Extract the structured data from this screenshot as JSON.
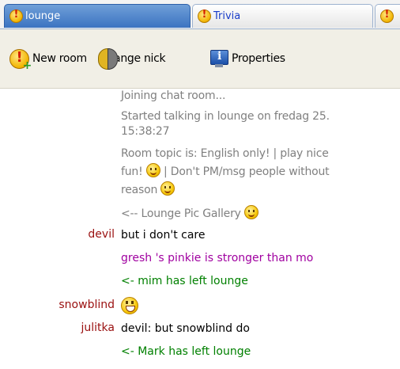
{
  "tabs": [
    {
      "label": "lounge",
      "active": true,
      "icon": "chat-bubble-icon"
    },
    {
      "label": "Trivia",
      "active": false,
      "icon": "chat-bubble-icon"
    },
    {
      "label": "",
      "active": false,
      "icon": "chat-bubble-icon"
    }
  ],
  "toolbar": {
    "new_room": "New room",
    "change_nick": "Change nick",
    "properties": "Properties"
  },
  "chat": {
    "system": {
      "joining": "Joining chat room...",
      "started": "Started talking in lounge on fredag 25.",
      "started_time": "15:38:27",
      "topic_line1": "Room topic is: English only! | play nice",
      "topic_line2_a": "fun!",
      "topic_line2_b": "| Don't PM/msg people without",
      "topic_line3": "reason",
      "gallery": "<-- Lounge Pic Gallery"
    },
    "messages": [
      {
        "nick": "devil",
        "text": "but i don't care"
      },
      {
        "nick": "",
        "text": "gresh 's pinkie is stronger than mo"
      },
      {
        "nick": "",
        "text": "<- mim has left lounge"
      },
      {
        "nick": "snowblind",
        "text": ""
      },
      {
        "nick": "julitka",
        "text": "devil: but snowblind do"
      },
      {
        "nick": "",
        "text": "<- Mark has left lounge"
      }
    ]
  },
  "colors": {
    "nick": "#9a1010",
    "action": "#a000a0",
    "leave": "#008000",
    "system": "#808080",
    "active_tab": "#3b73c1",
    "inactive_tab_text": "#1a3dc8"
  }
}
